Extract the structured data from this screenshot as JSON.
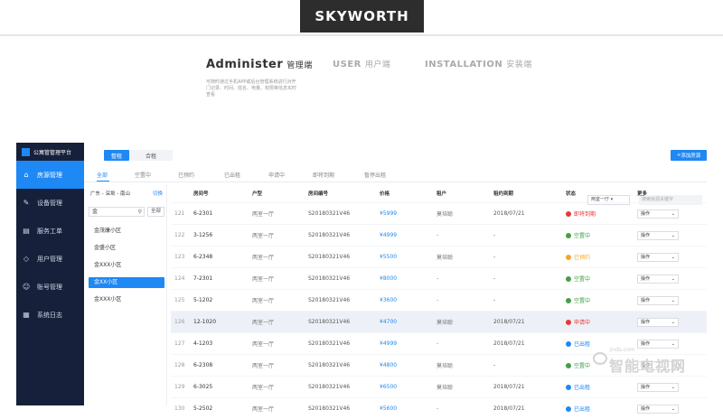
{
  "brand": "SKYWORTH",
  "header_tabs": [
    {
      "big": "Administer",
      "sub": "管理端",
      "active": true
    },
    {
      "big": "USER",
      "sub": "用户端",
      "active": false
    },
    {
      "big": "INSTALLATION",
      "sub": "安装端",
      "active": false
    }
  ],
  "header_desc": "可随时通过手机APP或后台管理系统进行对开门记录、时间、姓名、电量、权限等信息实时查看",
  "app_title": "公寓管管理平台",
  "sidebar": [
    {
      "label": "房源管理",
      "icon": "home-icon",
      "active": true
    },
    {
      "label": "设备管理",
      "icon": "wrench-icon",
      "active": false
    },
    {
      "label": "服务工单",
      "icon": "ticket-icon",
      "active": false
    },
    {
      "label": "用户管理",
      "icon": "user-diamond-icon",
      "active": false
    },
    {
      "label": "账号管理",
      "icon": "account-icon",
      "active": false
    },
    {
      "label": "系统日志",
      "icon": "log-icon",
      "active": false
    }
  ],
  "segment": {
    "active": "整租",
    "inactive": "合租"
  },
  "add_button": "添加房源",
  "status_tabs": [
    "全部",
    "空置中",
    "已预约",
    "已出租",
    "申请中",
    "即将到期",
    "暂停出租"
  ],
  "filter_select": "两室一厅",
  "filter_search_placeholder": "搜索房源关键字",
  "region": "广东 - 深圳 - 南山",
  "region_switch": "切换",
  "search_value": "金",
  "all_button": "全部",
  "communities": [
    "金茂康小区",
    "金盛小区",
    "金XXX小区",
    "金XX小区",
    "金XXX小区"
  ],
  "active_community_index": 3,
  "columns": [
    "房间号",
    "户型",
    "房间编号",
    "价格",
    "租户",
    "租约到期",
    "状态",
    "更多"
  ],
  "rows": [
    {
      "num": "121",
      "room": "6-2301",
      "type": "两室一厅",
      "code": "S20180321V46",
      "price": "¥5999",
      "tenant": "莫培聪",
      "due": "2018/07/21",
      "status": "即将到期",
      "status_color": "#e53935",
      "op": "操作"
    },
    {
      "num": "122",
      "room": "3-1256",
      "type": "两室一厅",
      "code": "S20180321V46",
      "price": "¥4999",
      "tenant": "-",
      "due": "-",
      "status": "空置中",
      "status_color": "#43a047",
      "op": "操作"
    },
    {
      "num": "123",
      "room": "6-2348",
      "type": "两室一厅",
      "code": "S20180321V46",
      "price": "¥5500",
      "tenant": "莫培聪",
      "due": "-",
      "status": "已预约",
      "status_color": "#f5a623",
      "op": "操作"
    },
    {
      "num": "124",
      "room": "7-2301",
      "type": "两室一厅",
      "code": "S20180321V46",
      "price": "¥8000",
      "tenant": "-",
      "due": "-",
      "status": "空置中",
      "status_color": "#43a047",
      "op": "操作"
    },
    {
      "num": "125",
      "room": "5-1202",
      "type": "两室一厅",
      "code": "S20180321V46",
      "price": "¥3600",
      "tenant": "-",
      "due": "-",
      "status": "空置中",
      "status_color": "#43a047",
      "op": "操作"
    },
    {
      "num": "126",
      "room": "12-1020",
      "type": "两室一厅",
      "code": "S20180321V46",
      "price": "¥4700",
      "tenant": "莫培聪",
      "due": "2018/07/21",
      "status": "申请中",
      "status_color": "#e53935",
      "op": "操作"
    },
    {
      "num": "127",
      "room": "4-1203",
      "type": "两室一厅",
      "code": "S20180321V46",
      "price": "¥4999",
      "tenant": "-",
      "due": "2018/07/21",
      "status": "已出租",
      "status_color": "#1e88f5",
      "op": "操作"
    },
    {
      "num": "128",
      "room": "6-2308",
      "type": "两室一厅",
      "code": "S20180321V46",
      "price": "¥4800",
      "tenant": "莫培聪",
      "due": "-",
      "status": "空置中",
      "status_color": "#43a047",
      "op": "操作"
    },
    {
      "num": "129",
      "room": "6-3025",
      "type": "两室一厅",
      "code": "S20180321V46",
      "price": "¥6500",
      "tenant": "莫培聪",
      "due": "2018/07/21",
      "status": "已出租",
      "status_color": "#1e88f5",
      "op": "操作"
    },
    {
      "num": "130",
      "room": "5-2502",
      "type": "两室一厅",
      "code": "S20180321V46",
      "price": "¥5600",
      "tenant": "-",
      "due": "2018/07/21",
      "status": "已出租",
      "status_color": "#1e88f5",
      "op": "操作"
    }
  ],
  "highlight_row_index": 5,
  "watermark": {
    "top": "znds.com",
    "main": "智能电视网"
  }
}
